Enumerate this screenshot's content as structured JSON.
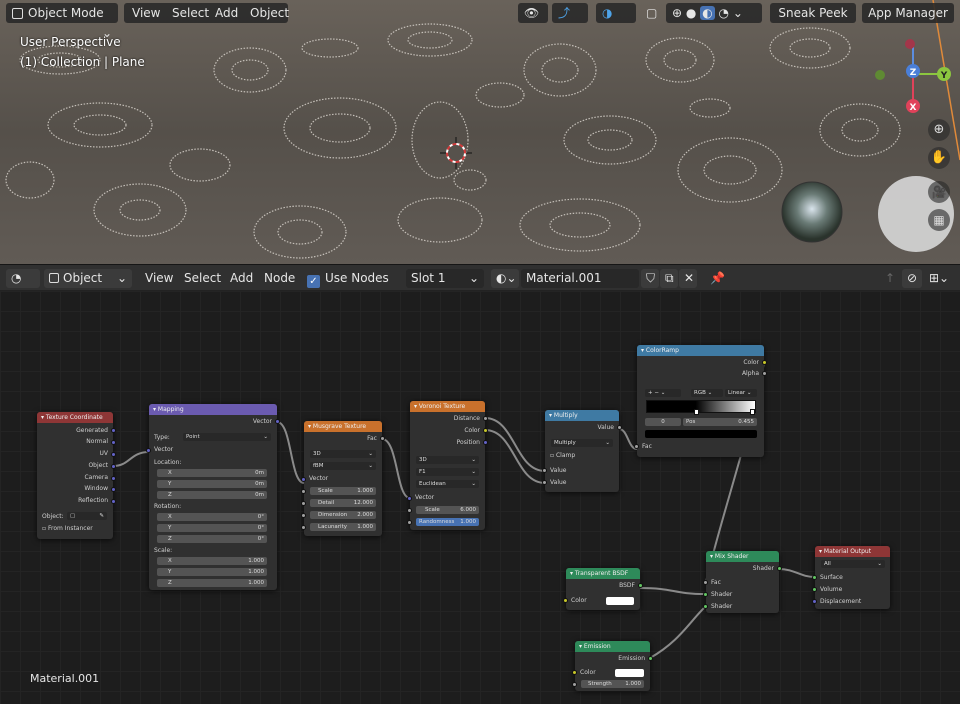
{
  "header": {
    "mode": "Object Mode",
    "menu": [
      "View",
      "Select",
      "Add",
      "Object"
    ],
    "sneak_peek": "Sneak Peek",
    "app_manager": "App Manager"
  },
  "viewport": {
    "perspective": "User Perspective",
    "collection": "(1) Collection | Plane",
    "gizmo": {
      "z": "Z",
      "y": "Y",
      "x": "X"
    }
  },
  "node_header": {
    "type": "Object",
    "menu": [
      "View",
      "Select",
      "Add",
      "Node"
    ],
    "use_nodes": "Use Nodes",
    "slot": "Slot 1",
    "material": "Material.001"
  },
  "editor": {
    "material_label": "Material.001"
  },
  "nodes": {
    "texcoord": {
      "title": "Texture Coordinate",
      "outputs": [
        "Generated",
        "Normal",
        "UV",
        "Object",
        "Camera",
        "Window",
        "Reflection"
      ],
      "object_label": "Object:",
      "from_instancer": "From Instancer"
    },
    "mapping": {
      "title": "Mapping",
      "out": "Vector",
      "type_label": "Type:",
      "type_value": "Point",
      "in_vector": "Vector",
      "location": "Location:",
      "rotation": "Rotation:",
      "scale": "Scale:",
      "loc": [
        [
          "X",
          "0m"
        ],
        [
          "Y",
          "0m"
        ],
        [
          "Z",
          "0m"
        ]
      ],
      "rot": [
        [
          "X",
          "0°"
        ],
        [
          "Y",
          "0°"
        ],
        [
          "Z",
          "0°"
        ]
      ],
      "scl": [
        [
          "X",
          "1.000"
        ],
        [
          "Y",
          "1.000"
        ],
        [
          "Z",
          "1.000"
        ]
      ]
    },
    "musgrave": {
      "title": "Musgrave Texture",
      "out": "Fac",
      "dim": "3D",
      "type": "fBM",
      "in_vector": "Vector",
      "fields": [
        [
          "Scale",
          "1.000"
        ],
        [
          "Detail",
          "12.000"
        ],
        [
          "Dimension",
          "2.000"
        ],
        [
          "Lacunarity",
          "1.000"
        ]
      ]
    },
    "voronoi": {
      "title": "Voronoi Texture",
      "outputs": [
        "Distance",
        "Color",
        "Position"
      ],
      "dim": "3D",
      "feature": "F1",
      "metric": "Euclidean",
      "in_vector": "Vector",
      "fields": [
        [
          "Scale",
          "6.000"
        ],
        [
          "Randomness",
          "1.000"
        ]
      ]
    },
    "multiply": {
      "title": "Multiply",
      "out": "Value",
      "op": "Multiply",
      "clamp": "Clamp",
      "inputs": [
        "Value",
        "Value"
      ]
    },
    "colorramp": {
      "title": "ColorRamp",
      "outputs": [
        "Color",
        "Alpha"
      ],
      "mode": "RGB",
      "interp": "Linear",
      "index": "0",
      "pos_label": "Pos",
      "pos_value": "0.455",
      "in_fac": "Fac"
    },
    "transparent": {
      "title": "Transparent BSDF",
      "out": "BSDF",
      "in_color": "Color"
    },
    "emission": {
      "title": "Emission",
      "out": "Emission",
      "in_color": "Color",
      "strength_label": "Strength",
      "strength_value": "1.000"
    },
    "mixshader": {
      "title": "Mix Shader",
      "out": "Shader",
      "inputs": [
        "Fac",
        "Shader",
        "Shader"
      ]
    },
    "output": {
      "title": "Material Output",
      "target": "All",
      "inputs": [
        "Surface",
        "Volume",
        "Displacement"
      ]
    }
  },
  "colors": {
    "tex_header": "#8e3636",
    "vec_header": "#6b5bb0",
    "texnode_header": "#c9712c",
    "conv_header": "#3f7aa3",
    "shader_header": "#2e8a5a",
    "out_header": "#8e3636"
  }
}
